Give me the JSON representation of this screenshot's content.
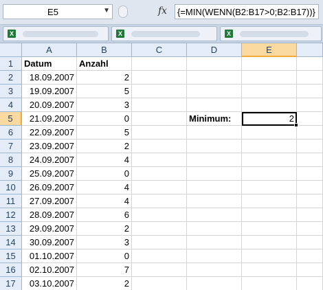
{
  "formula_bar": {
    "name_box": "E5",
    "formula": "{=MIN(WENN(B2:B17>0;B2:B17))}"
  },
  "workbook_tabs": [
    {
      "icon": "excel-file-icon"
    },
    {
      "icon": "excel-file-icon"
    },
    {
      "icon": "excel-file-icon"
    }
  ],
  "grid": {
    "columns": [
      "A",
      "B",
      "C",
      "D",
      "E"
    ],
    "active_column": "E",
    "active_row": 5,
    "headers": {
      "a": "Datum",
      "b": "Anzahl"
    },
    "rows": [
      {
        "n": "1"
      },
      {
        "n": "2",
        "date": "18.09.2007",
        "count": "2"
      },
      {
        "n": "3",
        "date": "19.09.2007",
        "count": "5"
      },
      {
        "n": "4",
        "date": "20.09.2007",
        "count": "3"
      },
      {
        "n": "5",
        "date": "21.09.2007",
        "count": "0"
      },
      {
        "n": "6",
        "date": "22.09.2007",
        "count": "5"
      },
      {
        "n": "7",
        "date": "23.09.2007",
        "count": "2"
      },
      {
        "n": "8",
        "date": "24.09.2007",
        "count": "4"
      },
      {
        "n": "9",
        "date": "25.09.2007",
        "count": "0"
      },
      {
        "n": "10",
        "date": "26.09.2007",
        "count": "4"
      },
      {
        "n": "11",
        "date": "27.09.2007",
        "count": "4"
      },
      {
        "n": "12",
        "date": "28.09.2007",
        "count": "6"
      },
      {
        "n": "13",
        "date": "29.09.2007",
        "count": "2"
      },
      {
        "n": "14",
        "date": "30.09.2007",
        "count": "3"
      },
      {
        "n": "15",
        "date": "01.10.2007",
        "count": "0"
      },
      {
        "n": "16",
        "date": "02.10.2007",
        "count": "7"
      },
      {
        "n": "17",
        "date": "03.10.2007",
        "count": "2"
      }
    ],
    "minimum_label": "Minimum:",
    "minimum_value": "2"
  }
}
